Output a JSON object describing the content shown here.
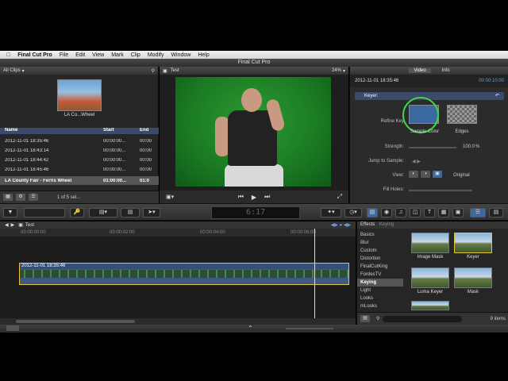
{
  "menubar": {
    "app": "Final Cut Pro",
    "items": [
      "File",
      "Edit",
      "View",
      "Mark",
      "Clip",
      "Modify",
      "Window",
      "Help"
    ]
  },
  "window_title": "Final Cut Pro",
  "browser": {
    "filter": "All Clips",
    "thumb_caption": "LA Co...Wheel",
    "columns": [
      "Name",
      "Start",
      "End"
    ],
    "rows": [
      {
        "name": "2012-11-01 18:35:46",
        "start": "00:00:00...",
        "end": "00:00"
      },
      {
        "name": "2012-11-01 18:43:14",
        "start": "00:00:00...",
        "end": "00:00"
      },
      {
        "name": "2012-11-01 18:44:42",
        "start": "00:00:00...",
        "end": "00:00"
      },
      {
        "name": "2012-11-01 18:45:46",
        "start": "00:00:00...",
        "end": "00:00"
      },
      {
        "name": "LA County Fair - Ferris Wheel",
        "start": "01:00:00...",
        "end": "01:0"
      }
    ],
    "footer_count": "1 of 5 sel..."
  },
  "viewer": {
    "title": "Test",
    "zoom": "24%"
  },
  "inspector": {
    "tabs": [
      "Video",
      "Info"
    ],
    "clip_name": "2012-11-01 18:35:46",
    "timecode": "00:00:10:00",
    "effect_name": "Keyer:",
    "refine_key_label": "Refine Key",
    "sample_color_label": "Sample Color",
    "edges_label": "Edges",
    "strength_label": "Strength:",
    "strength_value": "100.0",
    "strength_unit": "%",
    "jump_label": "Jump to Sample:",
    "view_label": "View:",
    "view_value": "Original",
    "fill_holes_label": "Fill Holes:"
  },
  "toolbar": {
    "timecode": "6:17"
  },
  "timeline": {
    "title": "Test",
    "ruler": [
      "00:00:00:00",
      "00:00:02:00",
      "00:00:04:00",
      "00:00:06:00"
    ],
    "clip_title": "2012-11-01 18:35:46"
  },
  "effects": {
    "title": "Effects",
    "subtitle": "Keying",
    "categories": [
      "Basics",
      "Blur",
      "Custom",
      "Distortion",
      "FinalCutKing",
      "FordesTV",
      "Keying",
      "Light",
      "Looks",
      "mLooks"
    ],
    "selected_category": "Keying",
    "items": [
      "Image Mask",
      "Keyer",
      "Luma Keyer",
      "Mask"
    ],
    "count": "9 items"
  },
  "colors": {
    "accent_blue": "#3b4b6b",
    "selection_ring": "#3cd84a",
    "clip_border": "#e6c43a"
  }
}
